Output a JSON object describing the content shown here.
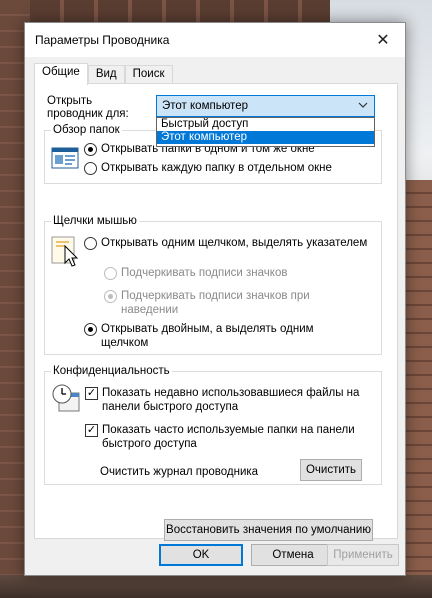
{
  "window": {
    "title": "Параметры Проводника",
    "close_glyph": "✕"
  },
  "tabs": [
    {
      "label": "Общие",
      "active": true
    },
    {
      "label": "Вид",
      "active": false
    },
    {
      "label": "Поиск",
      "active": false
    }
  ],
  "open_explorer": {
    "label": "Открыть проводник для:",
    "selected": "Этот компьютер",
    "options": [
      "Быстрый доступ",
      "Этот компьютер"
    ],
    "highlighted_option": "Этот компьютер"
  },
  "folder_browse": {
    "legend": "Обзор папок",
    "option_same_window": "Открывать папки в одном и том же окне",
    "option_new_window": "Открывать каждую папку в отдельном окне",
    "selected": "same_window"
  },
  "mouse_clicks": {
    "legend": "Щелчки мышью",
    "option_single": "Открывать одним щелчком, выделять указателем",
    "sub_option_underline_always": "Подчеркивать подписи значков",
    "sub_option_underline_hover": "Подчеркивать подписи значков при наведении",
    "option_double": "Открывать двойным, а выделять одним щелчком",
    "selected": "double"
  },
  "privacy": {
    "legend": "Конфиденциальность",
    "show_recent_files": "Показать недавно использовавшиеся файлы на панели быстрого доступа",
    "show_frequent_folders": "Показать часто используемые папки на панели быстрого доступа",
    "show_recent_files_checked": true,
    "show_frequent_folders_checked": true,
    "clear_history_label": "Очистить журнал проводника",
    "clear_button": "Очистить"
  },
  "restore_defaults_button": "Восстановить значения по умолчанию",
  "footer": {
    "ok": "OK",
    "cancel": "Отмена",
    "apply": "Применить"
  },
  "colors": {
    "accent": "#0078d7",
    "combo_bg": "#cce4f7"
  }
}
